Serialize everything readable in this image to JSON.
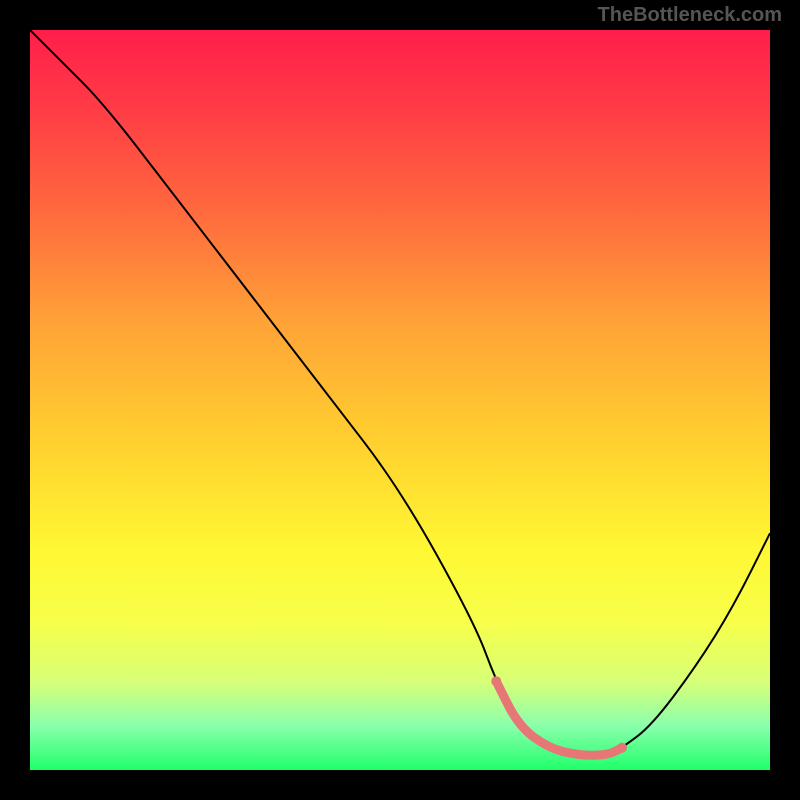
{
  "attribution": "TheBottleneck.com",
  "chart_data": {
    "type": "line",
    "title": "",
    "xlabel": "",
    "ylabel": "",
    "xlim": [
      0,
      100
    ],
    "ylim": [
      0,
      100
    ],
    "series": [
      {
        "name": "bottleneck-curve",
        "x": [
          0,
          4,
          10,
          20,
          30,
          40,
          50,
          60,
          63,
          66,
          70,
          74,
          78,
          80,
          84,
          90,
          95,
          100
        ],
        "y": [
          100,
          96,
          90,
          77,
          64,
          51,
          38,
          20,
          12,
          6,
          3,
          2,
          2,
          3,
          6,
          14,
          22,
          32
        ]
      },
      {
        "name": "highlight-band",
        "x": [
          63,
          66,
          70,
          74,
          78,
          80
        ],
        "y": [
          12,
          6,
          3,
          2,
          2,
          3
        ]
      }
    ],
    "gradient_stops": [
      {
        "pos": 0,
        "color": "#ff1e4a"
      },
      {
        "pos": 10,
        "color": "#ff3a46"
      },
      {
        "pos": 25,
        "color": "#ff6b3e"
      },
      {
        "pos": 40,
        "color": "#ffa437"
      },
      {
        "pos": 55,
        "color": "#ffce2f"
      },
      {
        "pos": 70,
        "color": "#fff733"
      },
      {
        "pos": 80,
        "color": "#f7ff4a"
      },
      {
        "pos": 88,
        "color": "#d8ff77"
      },
      {
        "pos": 94,
        "color": "#8bffad"
      },
      {
        "pos": 100,
        "color": "#20ff6a"
      }
    ]
  }
}
